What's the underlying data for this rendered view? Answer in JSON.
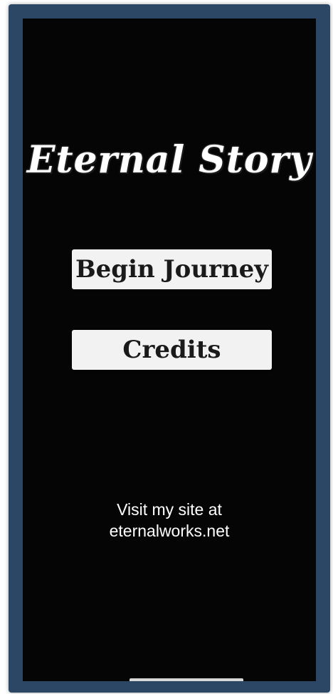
{
  "game": {
    "title": "Eternal Story"
  },
  "menu": {
    "begin_label": "Begin Journey",
    "credits_label": "Credits"
  },
  "footer": {
    "prefix": "Visit my site at",
    "link": "eternalworks.net"
  },
  "colors": {
    "frame": "#2c4666",
    "screen": "#050505",
    "button_bg": "#f2f2f2",
    "text": "#ffffff"
  }
}
